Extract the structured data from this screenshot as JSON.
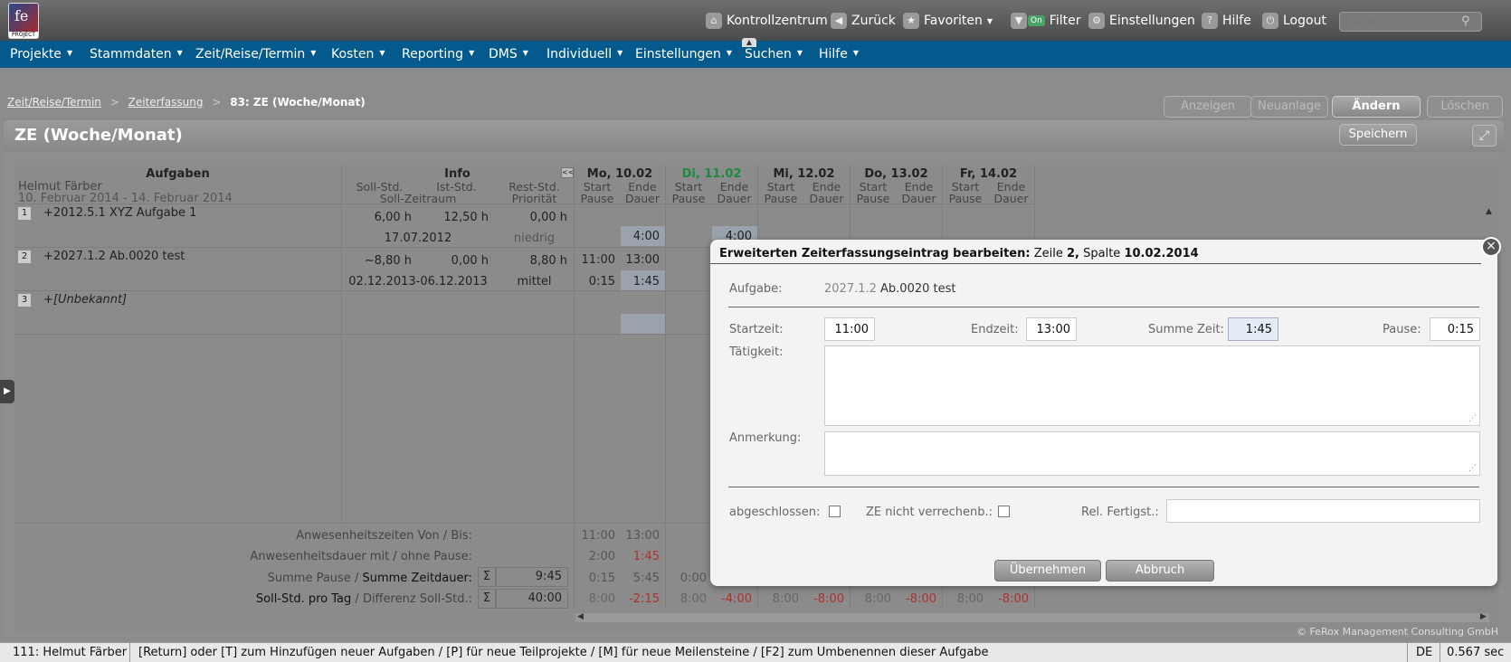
{
  "topbar": {
    "logo_text": "PROJECT",
    "links": [
      {
        "label": "Kontrollzentrum",
        "icon": "home-icon"
      },
      {
        "label": "Zurück",
        "icon": "back-arrow-icon"
      },
      {
        "label": "Favoriten",
        "icon": "star-icon"
      },
      {
        "label": "Filter",
        "icon": "filter-icon",
        "badge": "On"
      },
      {
        "label": "Einstellungen",
        "icon": "gear-icon"
      },
      {
        "label": "Hilfe",
        "icon": "help-icon"
      },
      {
        "label": "Logout",
        "icon": "logout-icon"
      }
    ],
    "search_placeholder": "Suche"
  },
  "menu": [
    "Projekte",
    "Stammdaten",
    "Zeit/Reise/Termin",
    "Kosten",
    "Reporting",
    "DMS",
    "Individuell",
    "Einstellungen",
    "Suchen",
    "Hilfe"
  ],
  "breadcrumb": {
    "item1": "Zeit/Reise/Termin",
    "item2": "Zeiterfassung",
    "current": "83: ZE (Woche/Monat)",
    "sep": ">"
  },
  "actions": {
    "anzeigen": "Anzeigen",
    "neuanlage": "Neuanlage",
    "aendern": "Ändern",
    "loeschen": "Löschen"
  },
  "panel": {
    "title": "ZE (Woche/Monat)",
    "save": "Speichern"
  },
  "grid": {
    "col_aufgaben": "Aufgaben",
    "col_info": "Info",
    "collapse": "<<",
    "user": "Helmut Färber",
    "range": "10. Februar 2014 - 14. Februar 2014",
    "info_sub1": [
      "Soll-Std.",
      "Ist-Std.",
      "Rest-Std."
    ],
    "info_sub2": [
      "Soll-Zeitraum",
      "Priorität"
    ],
    "days": [
      {
        "label": "Mo, 10.02",
        "today": false
      },
      {
        "label": "Di, 11.02",
        "today": true
      },
      {
        "label": "Mi, 12.02",
        "today": false
      },
      {
        "label": "Do, 13.02",
        "today": false
      },
      {
        "label": "Fr, 14.02",
        "today": false
      }
    ],
    "day_sub1": [
      "Start",
      "Ende"
    ],
    "day_sub2": [
      "Pause",
      "Dauer"
    ],
    "rows": [
      {
        "num": "1",
        "task": "+2012.5.1  XYZ Aufgabe 1",
        "soll": "6,00 h",
        "ist": "12,50 h",
        "rest": "0,00 h",
        "zeitraum": "17.07.2012",
        "prio": "niedrig",
        "mo_dauer": "4:00",
        "di_dauer": "4:00"
      },
      {
        "num": "2",
        "task": "+2027.1.2  Ab.0020 test",
        "soll": "~8,80 h",
        "ist": "0,00 h",
        "rest": "8,80 h",
        "zeitraum": "02.12.2013-06.12.2013",
        "prio": "mittel",
        "mo_start": "11:00",
        "mo_ende": "13:00",
        "mo_pause": "0:15",
        "mo_dauer": "1:45"
      },
      {
        "num": "3",
        "task": "+[Unbekannt]"
      }
    ],
    "summary": {
      "anwesenheit_label": "Anwesenheitszeiten Von / Bis:",
      "dauer_label": "Anwesenheitsdauer mit / ohne Pause:",
      "summe_label_a": "Summe Pause",
      "summe_label_b": "Summe Zeitdauer:",
      "soll_label_a": "Soll-Std. pro Tag",
      "soll_label_b": "Differenz Soll-Std.:",
      "sigma": "Σ",
      "summe_total": "9:45",
      "soll_total": "40:00",
      "slash": "/",
      "mo_von": "11:00",
      "mo_bis": "13:00",
      "mo_mit": "2:00",
      "mo_ohne": "1:45",
      "mo_pause": "0:15",
      "mo_dauer": "5:45",
      "di_pause": "0:00",
      "soll_values": [
        "8:00",
        "-2:15",
        "8:00",
        "-4:00",
        "8:00",
        "-8:00",
        "8:00",
        "-8:00",
        "8:00",
        "-8:00"
      ]
    },
    "copyright": "© FeRox Management Consulting GmbH"
  },
  "dialog": {
    "title_bold": "Erweiterten Zeiterfassungseintrag bearbeiten:",
    "title_zeile": "Zeile",
    "title_row": "2,",
    "title_spalte": "Spalte",
    "title_date": "10.02.2014",
    "aufgabe_label": "Aufgabe:",
    "aufgabe_code": "2027.1.2",
    "aufgabe_name": "Ab.0020 test",
    "startzeit_label": "Startzeit:",
    "startzeit": "11:00",
    "endzeit_label": "Endzeit:",
    "endzeit": "13:00",
    "summe_label": "Summe Zeit:",
    "summe": "1:45",
    "pause_label": "Pause:",
    "pause": "0:15",
    "taetigkeit_label": "Tätigkeit:",
    "anmerkung_label": "Anmerkung:",
    "abgeschlossen_label": "abgeschlossen:",
    "nicht_verrechenbar_label": "ZE nicht verrechenb.:",
    "fertigstellung_label": "Rel. Fertigst.:",
    "apply": "Übernehmen",
    "cancel": "Abbruch"
  },
  "status": {
    "user": "111: Helmut Färber",
    "hint": "[Return] oder [T] zum Hinzufügen neuer Aufgaben / [P] für neue Teilprojekte / [M] für neue Meilensteine / [F2] zum Umbenennen dieser Aufgabe",
    "lang": "DE",
    "time": "0.567 sec"
  },
  "colors": {
    "menubar": "#045a8d",
    "today": "#1e8a3e",
    "negative": "#b03030"
  }
}
